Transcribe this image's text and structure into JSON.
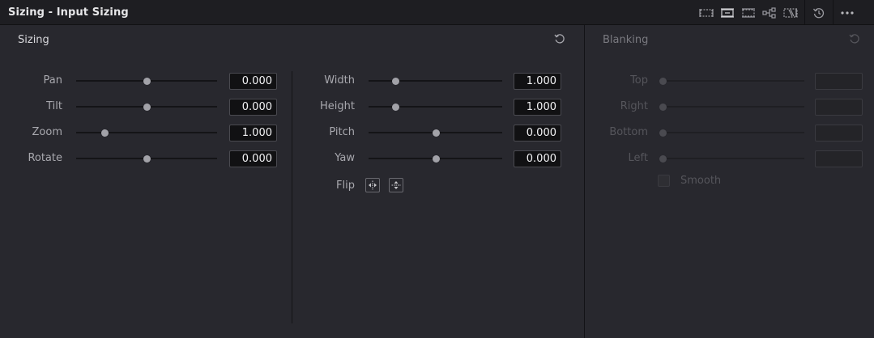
{
  "window": {
    "title": "Sizing - Input Sizing"
  },
  "toolbar": {
    "icons": [
      "sizing-mode-1-icon",
      "sizing-mode-2-icon",
      "sizing-mode-3-icon",
      "node-link-icon",
      "crop-overlay-icon",
      "history-icon",
      "more-options-icon"
    ]
  },
  "sizing": {
    "title": "Sizing",
    "left_params": [
      {
        "label": "Pan",
        "value": "0.000",
        "pos": 0.5
      },
      {
        "label": "Tilt",
        "value": "0.000",
        "pos": 0.5
      },
      {
        "label": "Zoom",
        "value": "1.000",
        "pos": 0.2
      },
      {
        "label": "Rotate",
        "value": "0.000",
        "pos": 0.5
      }
    ],
    "right_params": [
      {
        "label": "Width",
        "value": "1.000",
        "pos": 0.2
      },
      {
        "label": "Height",
        "value": "1.000",
        "pos": 0.2
      },
      {
        "label": "Pitch",
        "value": "0.000",
        "pos": 0.5
      },
      {
        "label": "Yaw",
        "value": "0.000",
        "pos": 0.5
      }
    ],
    "flip_label": "Flip"
  },
  "blanking": {
    "title": "Blanking",
    "params": [
      {
        "label": "Top",
        "value": "",
        "pos": 0.0
      },
      {
        "label": "Right",
        "value": "",
        "pos": 0.0
      },
      {
        "label": "Bottom",
        "value": "",
        "pos": 0.0
      },
      {
        "label": "Left",
        "value": "",
        "pos": 0.0
      }
    ],
    "smooth_label": "Smooth"
  }
}
